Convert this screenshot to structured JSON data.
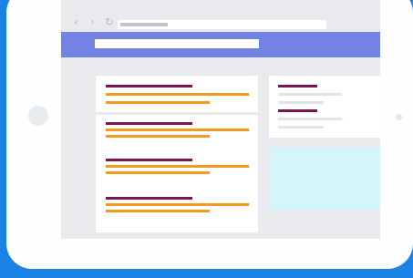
{
  "illustration": {
    "colors": {
      "background": "#1b82e6",
      "tablet": "#fefefe",
      "browser_chrome": "#e8eaed",
      "header": "#7283e3",
      "result_title": "#7d1650",
      "result_snippet": "#f39a1f",
      "sidebar_text": "#e1e4e8",
      "ad_block": "#d4f6fb"
    },
    "icons": {
      "back": "‹",
      "forward": "›",
      "reload": "↻"
    }
  }
}
